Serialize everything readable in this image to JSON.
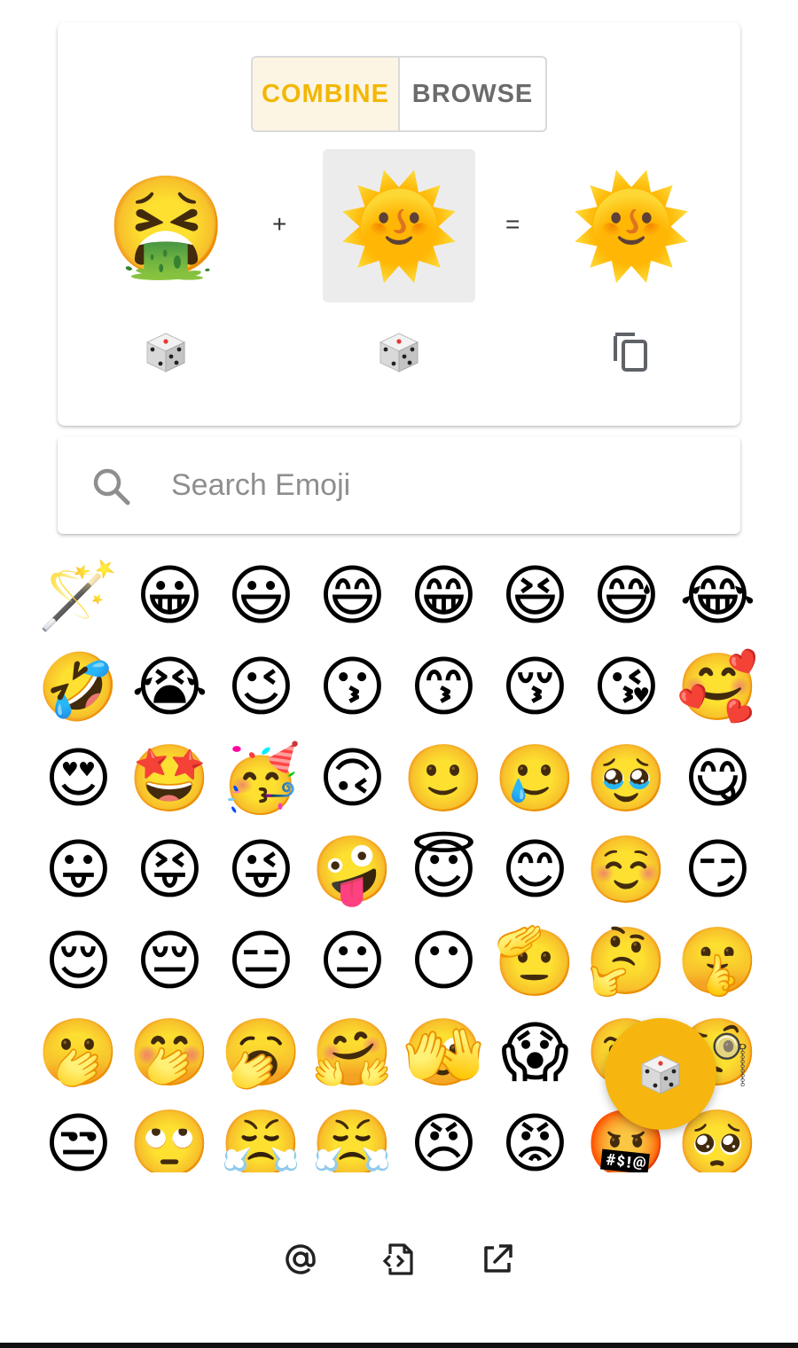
{
  "tabs": {
    "combine": "COMBINE",
    "browse": "BROWSE",
    "active": "combine"
  },
  "mixer": {
    "left_emoji": "🤮",
    "right_emoji": "🌞",
    "result_emoji": "🌞",
    "plus": "+",
    "equals": "="
  },
  "search": {
    "placeholder": "Search Emoji",
    "value": ""
  },
  "grid": {
    "items": [
      "🪄",
      "😀",
      "😃",
      "😄",
      "😁",
      "😆",
      "😅",
      "😂",
      "🤣",
      "😭",
      "😉",
      "😗",
      "😙",
      "😚",
      "😘",
      "🥰",
      "😍",
      "🤩",
      "🥳",
      "🙃",
      "🙂",
      "🥲",
      "🥹",
      "😋",
      "😛",
      "😝",
      "😜",
      "🤪",
      "😇",
      "😊",
      "☺️",
      "😏",
      "😌",
      "😔",
      "😑",
      "😐",
      "😶",
      "🫡",
      "🤔",
      "🤫",
      "🫢",
      "🤭",
      "🥱",
      "🤗",
      "🫣",
      "😱",
      "🤨",
      "🧐",
      "😒",
      "🙄",
      "😤",
      "😤",
      "😠",
      "😡",
      "🤬",
      "🥺"
    ]
  },
  "colors": {
    "accent": "#f2b705",
    "fab": "#f6b60f"
  },
  "icons": {
    "dice": "dice-icon",
    "copy": "copy-icon",
    "search": "search-icon",
    "at": "at-icon",
    "code": "code-file-icon",
    "external": "open-external-icon"
  }
}
